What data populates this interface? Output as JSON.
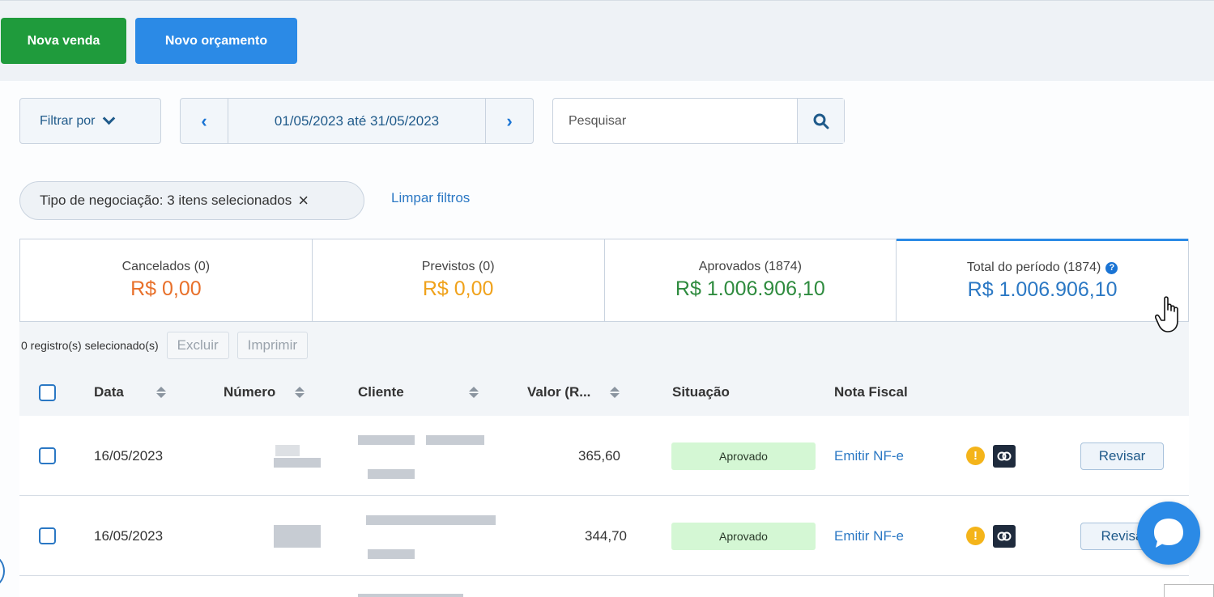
{
  "header": {
    "new_sale_label": "Nova venda",
    "new_quote_label": "Novo orçamento"
  },
  "filters": {
    "filter_by_label": "Filtrar por",
    "date_range": "01/05/2023 até 31/05/2023",
    "search_placeholder": "Pesquisar",
    "active_chip": "Tipo de negociação: 3 itens selecionados",
    "clear_label": "Limpar filtros"
  },
  "summary": [
    {
      "label": "Cancelados (0)",
      "value": "R$ 0,00",
      "color": "#e8702a"
    },
    {
      "label": "Previstos (0)",
      "value": "R$ 0,00",
      "color": "#f0a21b"
    },
    {
      "label": "Aprovados (1874)",
      "value": "R$ 1.006.906,10",
      "color": "#2e8b3e"
    },
    {
      "label": "Total do período (1874)",
      "value": "R$ 1.006.906,10",
      "color": "#2b78c4"
    }
  ],
  "actions": {
    "selected_count": "0 registro(s) selecionado(s)",
    "delete_label": "Excluir",
    "print_label": "Imprimir"
  },
  "table": {
    "columns": [
      "Data",
      "Número",
      "Cliente",
      "Valor (R...",
      "Situação",
      "Nota Fiscal"
    ],
    "rows": [
      {
        "date": "16/05/2023",
        "value": "365,60",
        "status": "Aprovado",
        "nfe": "Emitir NF-e",
        "review": "Revisar"
      },
      {
        "date": "16/05/2023",
        "value": "344,70",
        "status": "Aprovado",
        "nfe": "Emitir NF-e",
        "review": "Revisa"
      }
    ]
  },
  "icons": {
    "date_prev": "chevron-left-icon",
    "date_next": "chevron-right-icon",
    "search": "search-icon",
    "warning": "warning-icon",
    "link": "link-icon",
    "chat": "chat-icon"
  }
}
